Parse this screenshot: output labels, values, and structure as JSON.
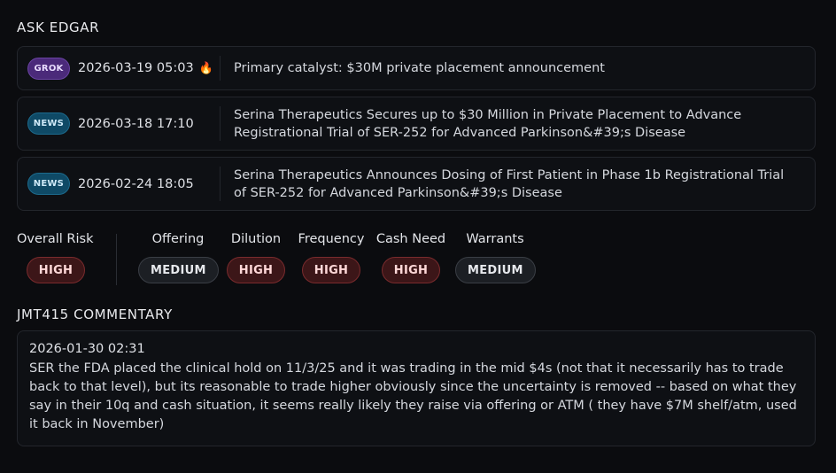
{
  "ask_section": {
    "title": "ASK EDGAR"
  },
  "news": [
    {
      "source": "GROK",
      "timestamp": "2026-03-19 05:03",
      "hot": true,
      "hot_icon": "fire-icon",
      "headline": "Primary catalyst: $30M private placement announcement"
    },
    {
      "source": "NEWS",
      "timestamp": "2026-03-18 17:10",
      "hot": false,
      "headline": "Serina Therapeutics Secures up to $30 Million in Private Placement to Advance Registrational Trial of SER-252 for Advanced Parkinson&#39;s Disease"
    },
    {
      "source": "NEWS",
      "timestamp": "2026-02-24 18:05",
      "hot": false,
      "headline": "Serina Therapeutics Announces Dosing of First Patient in Phase 1b Registrational Trial of SER-252 for Advanced Parkinson&#39;s Disease"
    }
  ],
  "risk": {
    "overall": {
      "label": "Overall Risk",
      "value": "HIGH"
    },
    "items": [
      {
        "label": "Offering",
        "value": "MEDIUM"
      },
      {
        "label": "Dilution",
        "value": "HIGH"
      },
      {
        "label": "Frequency",
        "value": "HIGH"
      },
      {
        "label": "Cash Need",
        "value": "HIGH"
      },
      {
        "label": "Warrants",
        "value": "MEDIUM"
      }
    ]
  },
  "commentary": {
    "title": "JMT415 COMMENTARY",
    "date": "2026-01-30 02:31",
    "text": "SER the FDA placed the clinical hold on 11/3/25 and it was trading in the mid $4s (not that it necessarily has to trade back to that level), but its reasonable to trade higher obviously since the uncertainty is removed -- based on what they say in their 10q and cash situation, it seems really likely they raise via offering or ATM ( they have $7M shelf/atm, used it back in November)"
  },
  "colors": {
    "background": "#0b0c0f",
    "card": "#0e1014",
    "border": "#23262c",
    "grok_badge": "#4b2a7a",
    "news_badge": "#0f4a66",
    "high_pill": "#3c1618",
    "medium_pill": "#1c1f24"
  }
}
